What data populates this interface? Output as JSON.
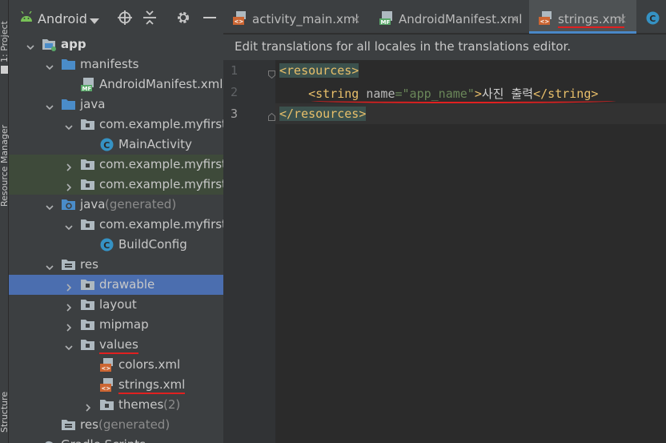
{
  "strip": {
    "project": "1: Project",
    "resource_manager": "Resource Manager",
    "structure": "Structure"
  },
  "header": {
    "view": "Android"
  },
  "tree": [
    {
      "label": "app",
      "bold": true,
      "depth": 0,
      "arrow": "down",
      "icon": "module-icon"
    },
    {
      "label": "manifests",
      "depth": 1,
      "arrow": "down",
      "icon": "folder-icon"
    },
    {
      "label": "AndroidManifest.xml",
      "depth": 2,
      "icon": "manifest-icon"
    },
    {
      "label": "java",
      "depth": 1,
      "arrow": "down",
      "icon": "folder-icon"
    },
    {
      "label": "com.example.myfirstwork",
      "depth": 2,
      "arrow": "down",
      "icon": "package-icon"
    },
    {
      "label": "MainActivity",
      "depth": 3,
      "icon": "class-icon"
    },
    {
      "label": "com.example.myfirstwork (",
      "depth": 2,
      "arrow": "right",
      "icon": "package-icon",
      "hl": "green"
    },
    {
      "label": "com.example.myfirstwork (",
      "depth": 2,
      "arrow": "right",
      "icon": "package-icon",
      "hl": "green"
    },
    {
      "label": "java",
      "secondary": " (generated)",
      "depth": 1,
      "arrow": "down",
      "icon": "generated-folder-icon"
    },
    {
      "label": "com.example.myfirstwork",
      "depth": 2,
      "arrow": "down",
      "icon": "package-icon"
    },
    {
      "label": "BuildConfig",
      "depth": 3,
      "icon": "class-icon"
    },
    {
      "label": "res",
      "depth": 1,
      "arrow": "down",
      "icon": "res-folder-icon"
    },
    {
      "label": "drawable",
      "depth": 2,
      "arrow": "right",
      "icon": "package-icon",
      "hl": "selected"
    },
    {
      "label": "layout",
      "depth": 2,
      "arrow": "right",
      "icon": "package-icon"
    },
    {
      "label": "mipmap",
      "depth": 2,
      "arrow": "right",
      "icon": "package-icon"
    },
    {
      "label": "values",
      "depth": 2,
      "arrow": "down",
      "icon": "package-icon",
      "underline": true
    },
    {
      "label": "colors.xml",
      "depth": 3,
      "icon": "xml-icon"
    },
    {
      "label": "strings.xml",
      "depth": 3,
      "icon": "xml-icon",
      "underline": true
    },
    {
      "label": "themes",
      "secondary": " (2)",
      "depth": 3,
      "arrow": "right",
      "icon": "package-icon"
    },
    {
      "label": "res",
      "secondary": " (generated)",
      "depth": 1,
      "icon": "res-folder-icon"
    },
    {
      "label": "Gradle Scripts",
      "depth": 0,
      "arrow": "right",
      "icon": "gradle-icon"
    }
  ],
  "tabs": [
    {
      "label": "activity_main.xml",
      "icon": "xml-icon",
      "close": "×"
    },
    {
      "label": "AndroidManifest.xml",
      "icon": "manifest-icon",
      "close": "×"
    },
    {
      "label": "strings.xml",
      "icon": "xml-icon",
      "close": "×",
      "active": true
    },
    {
      "label": "",
      "icon": "class-icon"
    }
  ],
  "banner": "Edit translations for all locales in the translations editor.",
  "editor": {
    "line_numbers": [
      "1",
      "2",
      "3"
    ],
    "line1": {
      "open": "<resources>"
    },
    "line2": {
      "open": "<string",
      "attr": "name",
      "eq": "=",
      "value": "\"app_name\"",
      "close_bracket": ">",
      "text": "사진 출력",
      "end_tag": "</string>"
    },
    "line3": {
      "close": "</resources>"
    }
  },
  "colors": {
    "accent": "#4a88c7",
    "selection": "#4b6eaf",
    "annotation": "#e02020",
    "tag": "#e8bf6a",
    "string": "#6a8759"
  }
}
